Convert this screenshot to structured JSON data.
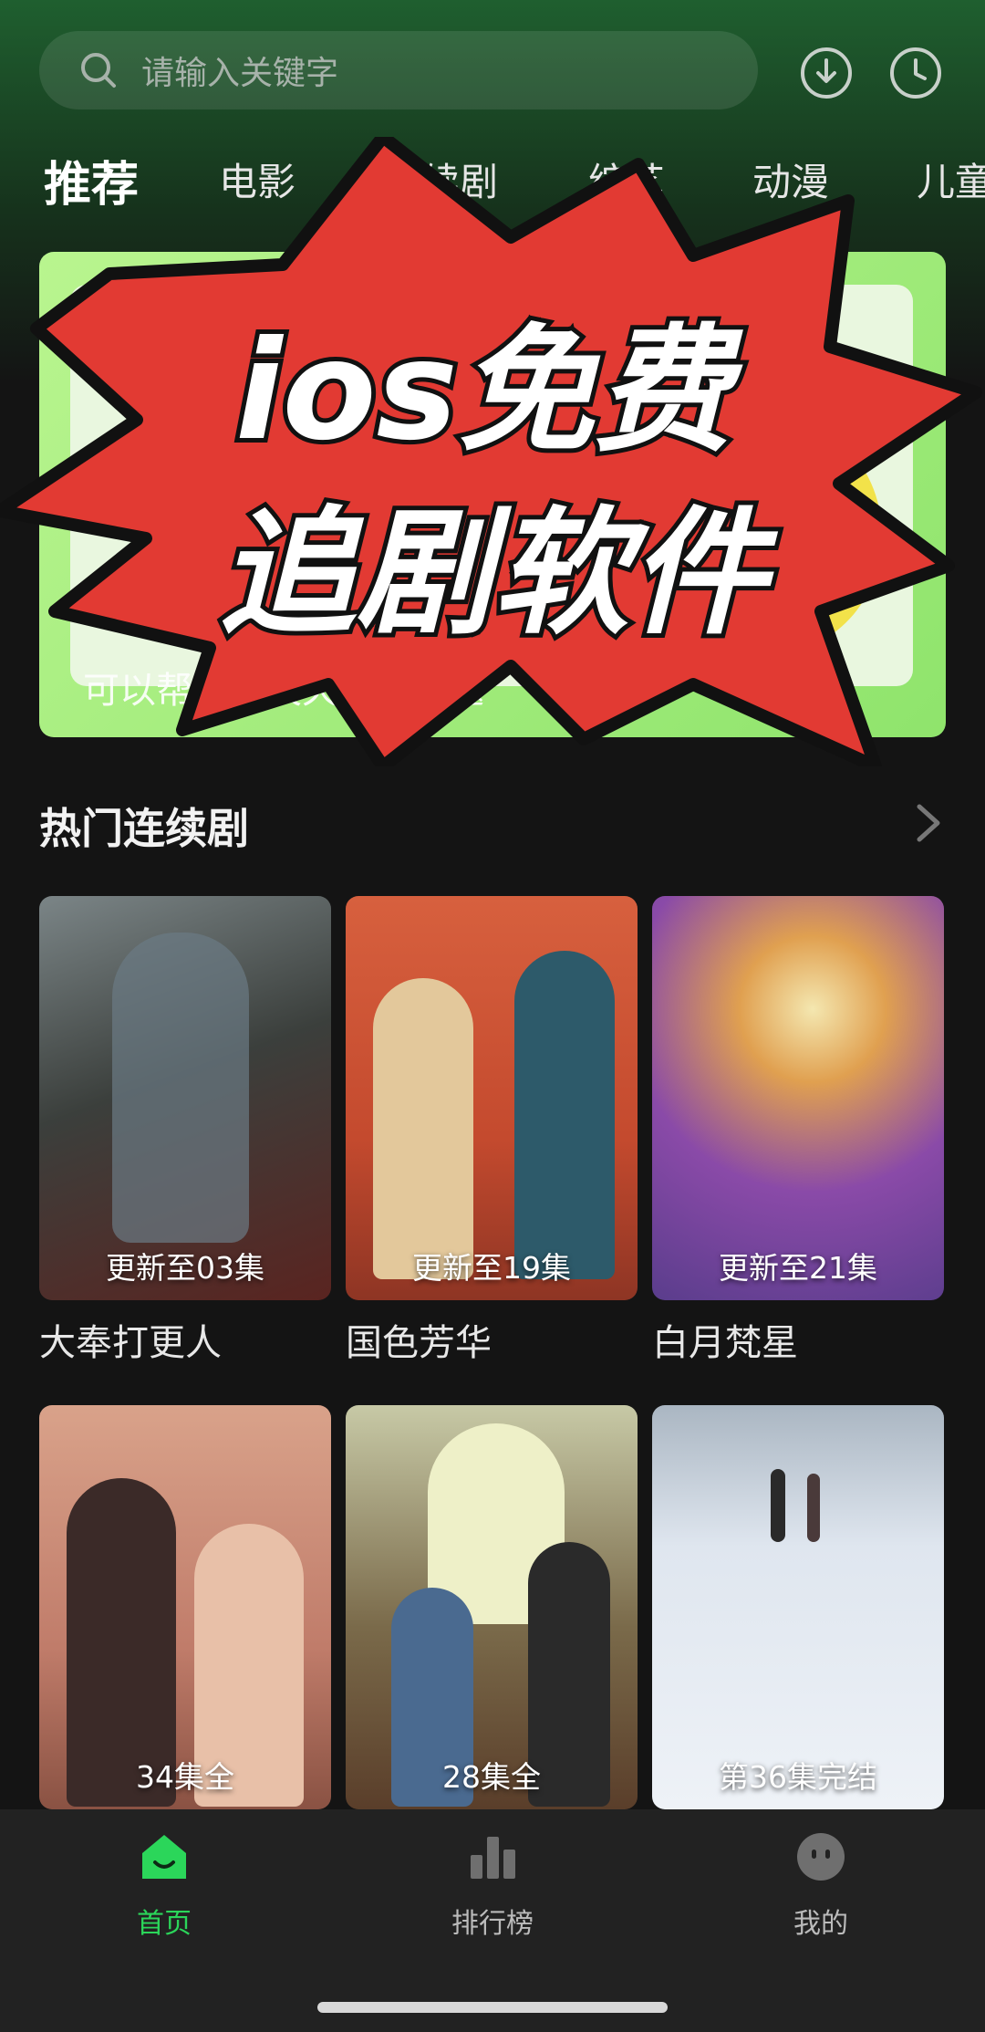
{
  "search": {
    "placeholder": "请输入关键字"
  },
  "top_icons": [
    "download-icon",
    "history-clock-icon"
  ],
  "tabs": [
    "推荐",
    "电影",
    "连续剧",
    "综艺",
    "动漫",
    "儿童"
  ],
  "banner": {
    "caption": "可以帮你聊天天人谈问题"
  },
  "overlay": {
    "line1": "ios免费",
    "line2": "追剧软件"
  },
  "section": {
    "title": "热门连续剧"
  },
  "row1": [
    {
      "title": "大奉打更人",
      "badge": "更新至03集"
    },
    {
      "title": "国色芳华",
      "badge": "更新至19集"
    },
    {
      "title": "白月梵星",
      "badge": "更新至21集"
    }
  ],
  "row2": [
    {
      "badge": "34集全"
    },
    {
      "badge": "28集全"
    },
    {
      "badge": "第36集完结"
    }
  ],
  "nav": [
    {
      "label": "首页",
      "icon": "home-icon"
    },
    {
      "label": "排行榜",
      "icon": "ranking-icon"
    },
    {
      "label": "我的",
      "icon": "profile-icon"
    }
  ],
  "colors": {
    "accent": "#2bd65a",
    "burst": "#e23a33"
  }
}
